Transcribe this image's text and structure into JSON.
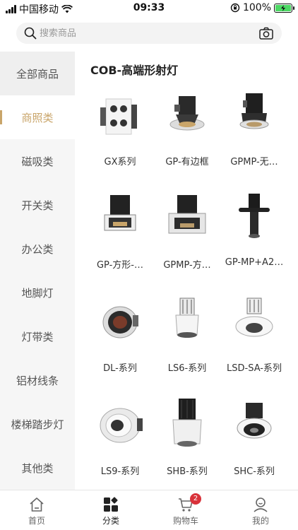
{
  "status_bar": {
    "carrier": "中国移动",
    "time": "09:33",
    "battery": "100%"
  },
  "search": {
    "placeholder": "搜索商品"
  },
  "sidebar": {
    "items": [
      {
        "label": "全部商品"
      },
      {
        "label": "商照类"
      },
      {
        "label": "磁吸类"
      },
      {
        "label": "开关类"
      },
      {
        "label": "办公类"
      },
      {
        "label": "地脚灯"
      },
      {
        "label": "灯带类"
      },
      {
        "label": "铝材线条"
      },
      {
        "label": "楼梯踏步灯"
      },
      {
        "label": "其他类"
      }
    ]
  },
  "content": {
    "title": "COB-高端形射灯",
    "products": [
      {
        "name": "GX系列"
      },
      {
        "name": "GP-有边框"
      },
      {
        "name": "GPMP-无…"
      },
      {
        "name": "GP-方形-…"
      },
      {
        "name": "GPMP-方…"
      },
      {
        "name": "GP-MP+A2…"
      },
      {
        "name": "DL-系列"
      },
      {
        "name": "LS6-系列"
      },
      {
        "name": "LSD-SA-系列"
      },
      {
        "name": "LS9-系列"
      },
      {
        "name": "SHB-系列"
      },
      {
        "name": "SHC-系列"
      }
    ]
  },
  "tab_bar": {
    "tabs": [
      {
        "label": "首页",
        "icon": "home-icon"
      },
      {
        "label": "分类",
        "icon": "category-icon"
      },
      {
        "label": "购物车",
        "icon": "cart-icon"
      },
      {
        "label": "我的",
        "icon": "profile-icon"
      }
    ],
    "cart_badge": "2"
  },
  "colors": {
    "accent": "#c9a56a",
    "badge": "#d9323a",
    "battery_fill": "#4cd964"
  }
}
